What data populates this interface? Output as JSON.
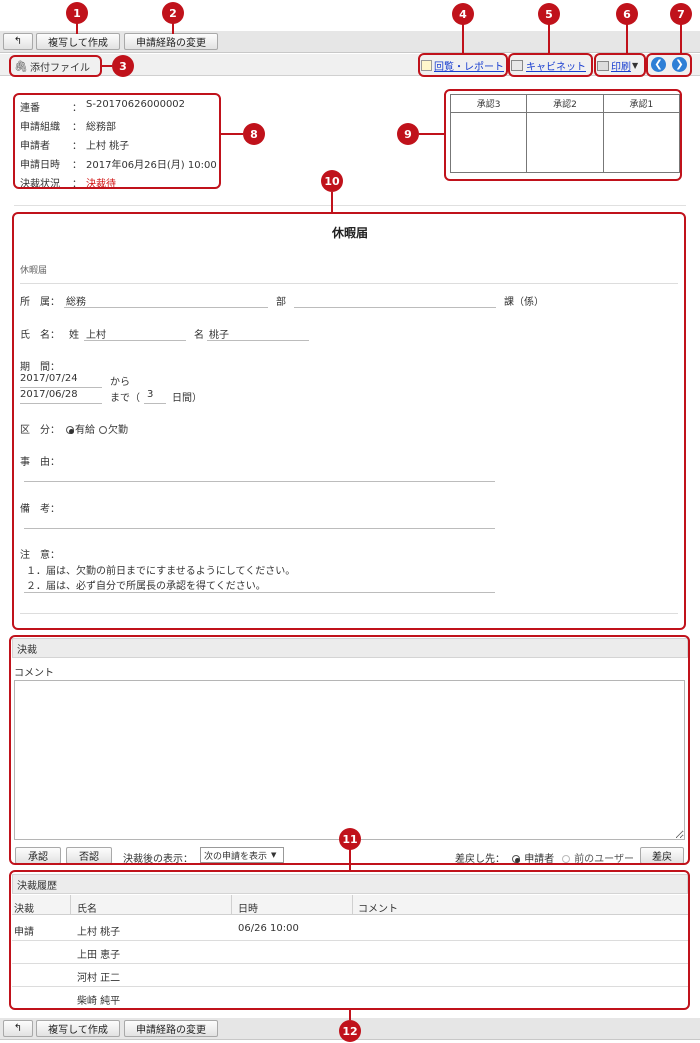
{
  "toolbar": {
    "copy_create": "複写して作成",
    "change_route": "申請経路の変更",
    "back_glyph": "↰"
  },
  "attach": {
    "label": "添付ファイル",
    "circulation": "回覧・レポート",
    "cabinet": "キャビネット",
    "print": "印刷"
  },
  "info": {
    "serial_label": "連番",
    "serial_value": "S-20170626000002",
    "org_label": "申請組織",
    "org_value": "総務部",
    "applicant_label": "申請者",
    "applicant_value": "上村 桃子",
    "date_label": "申請日時",
    "date_value": "2017年06月26日(月) 10:00",
    "status_label": "決裁状況",
    "status_value": "決裁待",
    "colon": "："
  },
  "approvals": [
    "承認3",
    "承認2",
    "承認1"
  ],
  "form": {
    "title": "休暇届",
    "subtitle": "休暇届",
    "dept_label": "所　属：",
    "dept_value": "総務",
    "bu": "部",
    "ka": "課（係）",
    "name_label": "氏　名：",
    "sei": "姓",
    "sei_value": "上村",
    "mei": "名",
    "mei_value": "桃子",
    "period_label": "期　間：",
    "from_date": "2017/07/24",
    "from_text": "から",
    "to_date": "2017/06/28",
    "to_text": "まで（",
    "days": "3",
    "days_text": "日間）",
    "kubun_label": "区　分：",
    "paid": "有給",
    "absent": "欠勤",
    "reason_label": "事　由：",
    "remarks_label": "備　考：",
    "notes_label": "注　意：",
    "note1": "１．届は、欠勤の前日までにすませるようにしてください。",
    "note2": "２．届は、必ず自分で所属長の承認を得てください。"
  },
  "decision": {
    "header": "決裁",
    "comment_label": "コメント",
    "approve": "承認",
    "reject": "否認",
    "after_label": "決裁後の表示：",
    "after_value": "次の申請を表示",
    "return_label": "差戻し先：",
    "return_applicant": "申請者",
    "return_prev": "前のユーザー",
    "return_btn": "差戻"
  },
  "history": {
    "header": "決裁履歴",
    "columns": [
      "決裁",
      "氏名",
      "日時",
      "コメント"
    ],
    "rows": [
      {
        "decision": "申請",
        "name": "上村 桃子",
        "time": "06/26 10:00"
      },
      {
        "decision": "",
        "name": "上田 恵子",
        "time": ""
      },
      {
        "decision": "",
        "name": "河村 正二",
        "time": ""
      },
      {
        "decision": "",
        "name": "柴崎 純平",
        "time": ""
      }
    ]
  },
  "markers": [
    "1",
    "2",
    "3",
    "4",
    "5",
    "6",
    "7",
    "8",
    "9",
    "10",
    "11",
    "12"
  ],
  "colors": {
    "marker": "#c0121b",
    "link": "#1a3fd0",
    "status": "#d01010",
    "nav": "#2e7fd6"
  }
}
